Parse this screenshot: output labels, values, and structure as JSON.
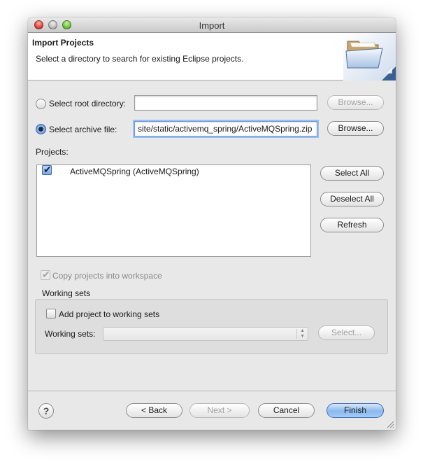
{
  "window": {
    "title": "Import"
  },
  "banner": {
    "title": "Import Projects",
    "description": "Select a directory to search for existing Eclipse projects.",
    "icon": "folder-open-icon"
  },
  "source": {
    "root_directory_label": "Select root directory:",
    "root_directory_value": "",
    "root_browse_label": "Browse...",
    "archive_file_label": "Select archive file:",
    "archive_file_value": "site/static/activemq_spring/ActiveMQSpring.zip",
    "archive_browse_label": "Browse...",
    "selected": "archive"
  },
  "projects": {
    "label": "Projects:",
    "items": [
      {
        "label": "ActiveMQSpring (ActiveMQSpring)",
        "checked": true
      }
    ],
    "select_all_label": "Select All",
    "deselect_all_label": "Deselect All",
    "refresh_label": "Refresh"
  },
  "options": {
    "copy_label": "Copy projects into workspace",
    "copy_checked": true,
    "copy_enabled": false
  },
  "working_sets": {
    "group_label": "Working sets",
    "add_label": "Add project to working sets",
    "add_checked": false,
    "sets_label": "Working sets:",
    "sets_value": "",
    "select_label": "Select..."
  },
  "footer": {
    "help_label": "?",
    "back_label": "< Back",
    "next_label": "Next >",
    "cancel_label": "Cancel",
    "finish_label": "Finish"
  },
  "colors": {
    "accent": "#6a9be0",
    "default_button": "#8ab8ef",
    "close": "#e0443c",
    "zoom": "#6fc33d"
  }
}
